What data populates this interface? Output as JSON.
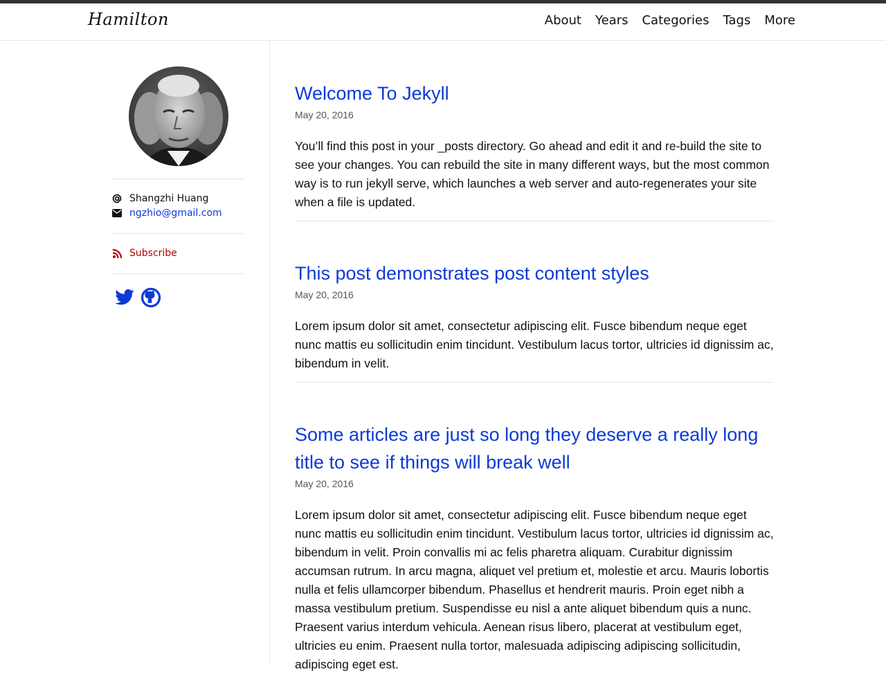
{
  "site": {
    "brand": "Hamilton",
    "nav": [
      "About",
      "Years",
      "Categories",
      "Tags",
      "More"
    ]
  },
  "sidebar": {
    "author_name": "Shangzhi Huang",
    "email": "ngzhio@gmail.com",
    "subscribe_label": "Subscribe",
    "social_icons": [
      "twitter-icon",
      "github-icon"
    ]
  },
  "colors": {
    "link": "#0c3ad8",
    "subscribe": "#b30000",
    "top_bar": "#333333"
  },
  "posts": [
    {
      "title": "Welcome To Jekyll",
      "date": "May 20, 2016",
      "excerpt": "You’ll find this post in your _posts directory. Go ahead and edit it and re-build the site to see your changes. You can rebuild the site in many different ways, but the most common way is to run jekyll serve, which launches a web server and auto-regenerates your site when a file is updated."
    },
    {
      "title": "This post demonstrates post content styles",
      "date": "May 20, 2016",
      "excerpt": "Lorem ipsum dolor sit amet, consectetur adipiscing elit. Fusce bibendum neque eget nunc mattis eu sollicitudin enim tincidunt. Vestibulum lacus tortor, ultricies id dignissim ac, bibendum in velit."
    },
    {
      "title": "Some articles are just so long they deserve a really long title to see if things will break well",
      "date": "May 20, 2016",
      "excerpt": "Lorem ipsum dolor sit amet, consectetur adipiscing elit. Fusce bibendum neque eget nunc mattis eu sollicitudin enim tincidunt. Vestibulum lacus tortor, ultricies id dignissim ac, bibendum in velit. Proin convallis mi ac felis pharetra aliquam. Curabitur dignissim accumsan rutrum. In arcu magna, aliquet vel pretium et, molestie et arcu. Mauris lobortis nulla et felis ullamcorper bibendum. Phasellus et hendrerit mauris. Proin eget nibh a massa vestibulum pretium. Suspendisse eu nisl a ante aliquet bibendum quis a nunc. Praesent varius interdum vehicula. Aenean risus libero, placerat at vestibulum eget, ultricies eu enim. Praesent nulla tortor, malesuada adipiscing adipiscing sollicitudin, adipiscing eget est."
    }
  ]
}
